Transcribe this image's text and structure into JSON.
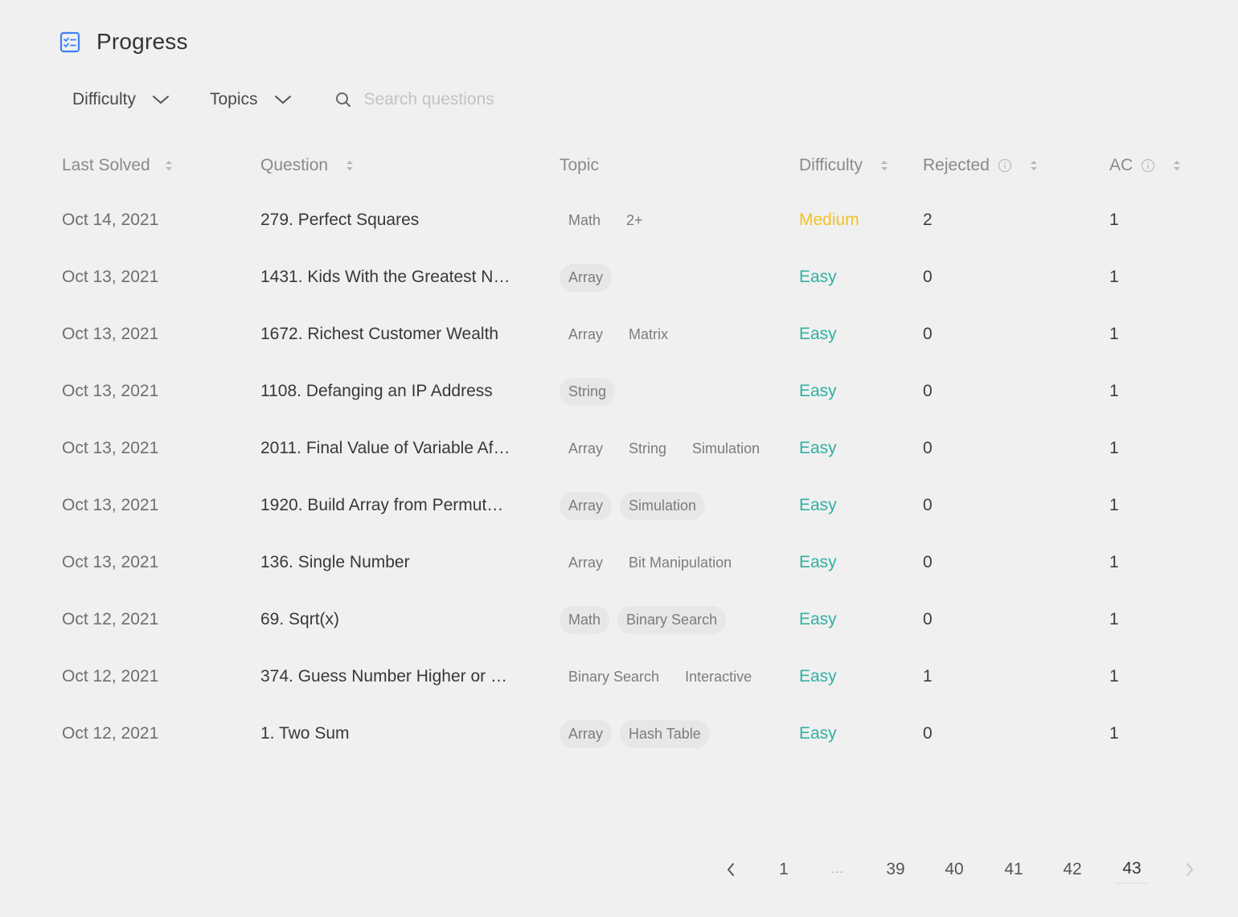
{
  "header": {
    "title": "Progress",
    "icon": "checklist-icon"
  },
  "filters": {
    "difficulty_label": "Difficulty",
    "topics_label": "Topics",
    "search_placeholder": "Search questions"
  },
  "table": {
    "headers": {
      "last_solved": "Last Solved",
      "question": "Question",
      "topic": "Topic",
      "difficulty": "Difficulty",
      "rejected": "Rejected",
      "ac": "AC"
    },
    "rows": [
      {
        "date": "Oct 14, 2021",
        "question": "279. Perfect Squares",
        "tags": [
          {
            "label": "Math",
            "style": "plain"
          },
          {
            "label": "2+",
            "style": "plain"
          }
        ],
        "difficulty": "Medium",
        "rejected": "2",
        "ac": "1"
      },
      {
        "date": "Oct 13, 2021",
        "question": "1431. Kids With the Greatest N…",
        "tags": [
          {
            "label": "Array",
            "style": "filled"
          }
        ],
        "difficulty": "Easy",
        "rejected": "0",
        "ac": "1"
      },
      {
        "date": "Oct 13, 2021",
        "question": "1672. Richest Customer Wealth",
        "tags": [
          {
            "label": "Array",
            "style": "plain"
          },
          {
            "label": "Matrix",
            "style": "plain"
          }
        ],
        "difficulty": "Easy",
        "rejected": "0",
        "ac": "1"
      },
      {
        "date": "Oct 13, 2021",
        "question": "1108. Defanging an IP Address",
        "tags": [
          {
            "label": "String",
            "style": "filled"
          }
        ],
        "difficulty": "Easy",
        "rejected": "0",
        "ac": "1"
      },
      {
        "date": "Oct 13, 2021",
        "question": "2011. Final Value of Variable Af…",
        "tags": [
          {
            "label": "Array",
            "style": "plain"
          },
          {
            "label": "String",
            "style": "plain"
          },
          {
            "label": "Simulation",
            "style": "plain"
          }
        ],
        "difficulty": "Easy",
        "rejected": "0",
        "ac": "1"
      },
      {
        "date": "Oct 13, 2021",
        "question": "1920. Build Array from Permut…",
        "tags": [
          {
            "label": "Array",
            "style": "filled"
          },
          {
            "label": "Simulation",
            "style": "filled"
          }
        ],
        "difficulty": "Easy",
        "rejected": "0",
        "ac": "1"
      },
      {
        "date": "Oct 13, 2021",
        "question": "136. Single Number",
        "tags": [
          {
            "label": "Array",
            "style": "plain"
          },
          {
            "label": "Bit Manipulation",
            "style": "plain"
          }
        ],
        "difficulty": "Easy",
        "rejected": "0",
        "ac": "1"
      },
      {
        "date": "Oct 12, 2021",
        "question": "69. Sqrt(x)",
        "tags": [
          {
            "label": "Math",
            "style": "filled"
          },
          {
            "label": "Binary Search",
            "style": "filled"
          }
        ],
        "difficulty": "Easy",
        "rejected": "0",
        "ac": "1"
      },
      {
        "date": "Oct 12, 2021",
        "question": "374. Guess Number Higher or …",
        "tags": [
          {
            "label": "Binary Search",
            "style": "plain"
          },
          {
            "label": "Interactive",
            "style": "plain"
          }
        ],
        "difficulty": "Easy",
        "rejected": "1",
        "ac": "1"
      },
      {
        "date": "Oct 12, 2021",
        "question": "1. Two Sum",
        "tags": [
          {
            "label": "Array",
            "style": "filled"
          },
          {
            "label": "Hash Table",
            "style": "filled"
          }
        ],
        "difficulty": "Easy",
        "rejected": "0",
        "ac": "1"
      }
    ]
  },
  "pagination": {
    "pages": [
      "1",
      "…",
      "39",
      "40",
      "41",
      "42",
      "43"
    ],
    "active": "43"
  },
  "colors": {
    "easy": "#2fb0a3",
    "medium": "#f0c420",
    "accent": "#3b82f6"
  }
}
